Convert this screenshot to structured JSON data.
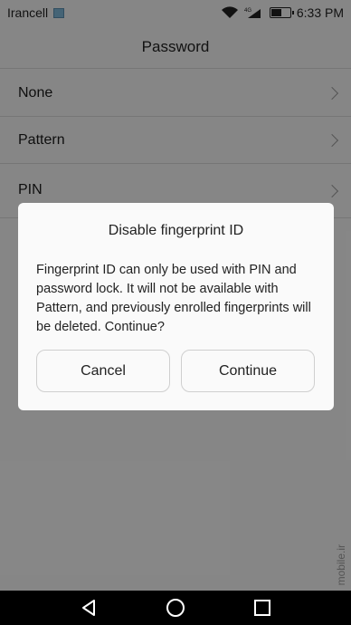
{
  "status_bar": {
    "carrier": "Irancell",
    "network": "4G",
    "time": "6:33 PM",
    "battery_level": 0.6
  },
  "title": "Password",
  "list": {
    "items": [
      {
        "label": "None"
      },
      {
        "label": "Pattern"
      },
      {
        "label": "PIN",
        "sub": ""
      }
    ]
  },
  "dialog": {
    "title": "Disable fingerprint ID",
    "message": "Fingerprint ID can only be used with PIN and password lock. It will not be available with Pattern, and previously enrolled fingerprints will be deleted. Continue?",
    "cancel_label": "Cancel",
    "continue_label": "Continue"
  },
  "watermark": "mobile.ir",
  "colors": {
    "scrim": "#000000",
    "dialog_bg": "#fafafa"
  }
}
